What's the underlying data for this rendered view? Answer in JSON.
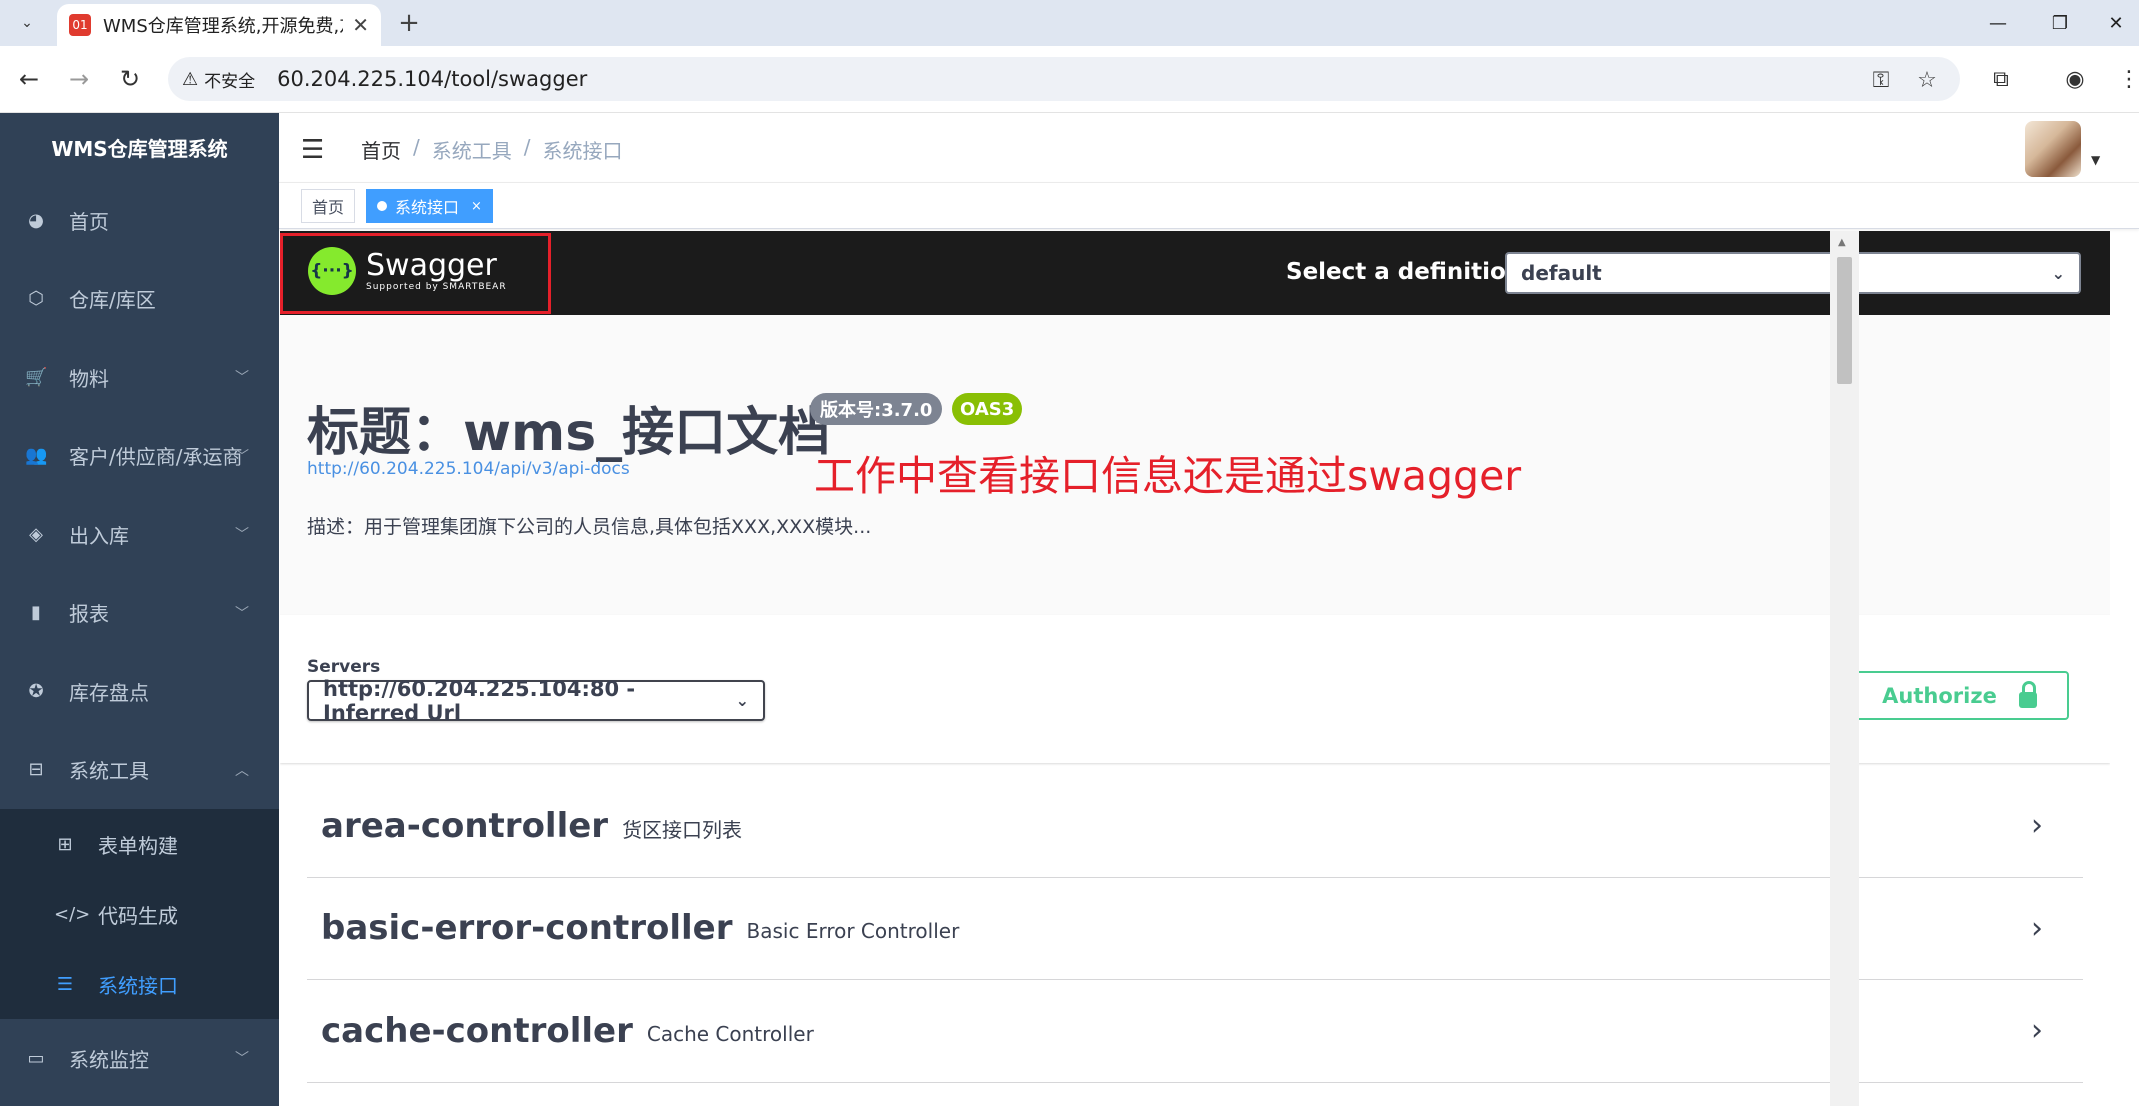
{
  "browser": {
    "tab_icon_text": "01",
    "tab_title": "WMS仓库管理系统,开源免费,友",
    "tab_close": "✕",
    "new_tab": "+",
    "insecure_label": "不安全",
    "url": "60.204.225.104/tool/swagger"
  },
  "sidebar": {
    "title": "WMS仓库管理系统",
    "items": [
      {
        "label": "首页",
        "icon": "dashboard-icon",
        "glyph": "◕",
        "arrow": ""
      },
      {
        "label": "仓库/库区",
        "icon": "warehouse-icon",
        "glyph": "⬡",
        "arrow": ""
      },
      {
        "label": "物料",
        "icon": "cart-icon",
        "glyph": "🛒",
        "arrow": "﹀"
      },
      {
        "label": "客户/供应商/承运商",
        "icon": "people-icon",
        "glyph": "👥",
        "arrow": "﹀"
      },
      {
        "label": "出入库",
        "icon": "layers-icon",
        "glyph": "◈",
        "arrow": "﹀"
      },
      {
        "label": "报表",
        "icon": "bar-chart-icon",
        "glyph": "▮",
        "arrow": "﹀"
      },
      {
        "label": "库存盘点",
        "icon": "cycle-icon",
        "glyph": "✪",
        "arrow": ""
      },
      {
        "label": "系统工具",
        "icon": "toolbox-icon",
        "glyph": "⊟",
        "arrow": "︿"
      }
    ],
    "sub_items": [
      {
        "label": "表单构建",
        "glyph": "⊞"
      },
      {
        "label": "代码生成",
        "glyph": "</>"
      },
      {
        "label": "系统接口",
        "glyph": "☰"
      }
    ],
    "last_item": {
      "label": "系统监控",
      "glyph": "▭",
      "arrow": "﹀"
    }
  },
  "header": {
    "breadcrumb": [
      "首页",
      "系统工具",
      "系统接口"
    ],
    "separator": "/"
  },
  "tags": {
    "home": "首页",
    "active": "系统接口",
    "close": "×"
  },
  "swagger": {
    "logo_mark": "{···}",
    "brand": "Swagger",
    "brand_sub": "Supported by SMARTBEAR",
    "definition_label": "Select a definition",
    "definition_value": "default",
    "title": "标题：wms_接口文档",
    "version_badge": "版本号:3.7.0",
    "oas_badge": "OAS3",
    "docs_link": "http://60.204.225.104/api/v3/api-docs",
    "description": "描述：用于管理集团旗下公司的人员信息,具体包括XXX,XXX模块...",
    "servers_label": "Servers",
    "server_value": "http://60.204.225.104:80 - Inferred Url",
    "authorize_label": "Authorize",
    "controllers": [
      {
        "name": "area-controller",
        "desc": "货区接口列表"
      },
      {
        "name": "basic-error-controller",
        "desc": "Basic Error Controller"
      },
      {
        "name": "cache-controller",
        "desc": "Cache Controller"
      }
    ]
  },
  "annotation": "工作中查看接口信息还是通过swagger",
  "colors": {
    "sidebar_bg": "#304156",
    "accent": "#409eff",
    "swagger_green": "#85ea2d",
    "authorize_green": "#49cc90",
    "annotation_red": "#e5202a"
  }
}
